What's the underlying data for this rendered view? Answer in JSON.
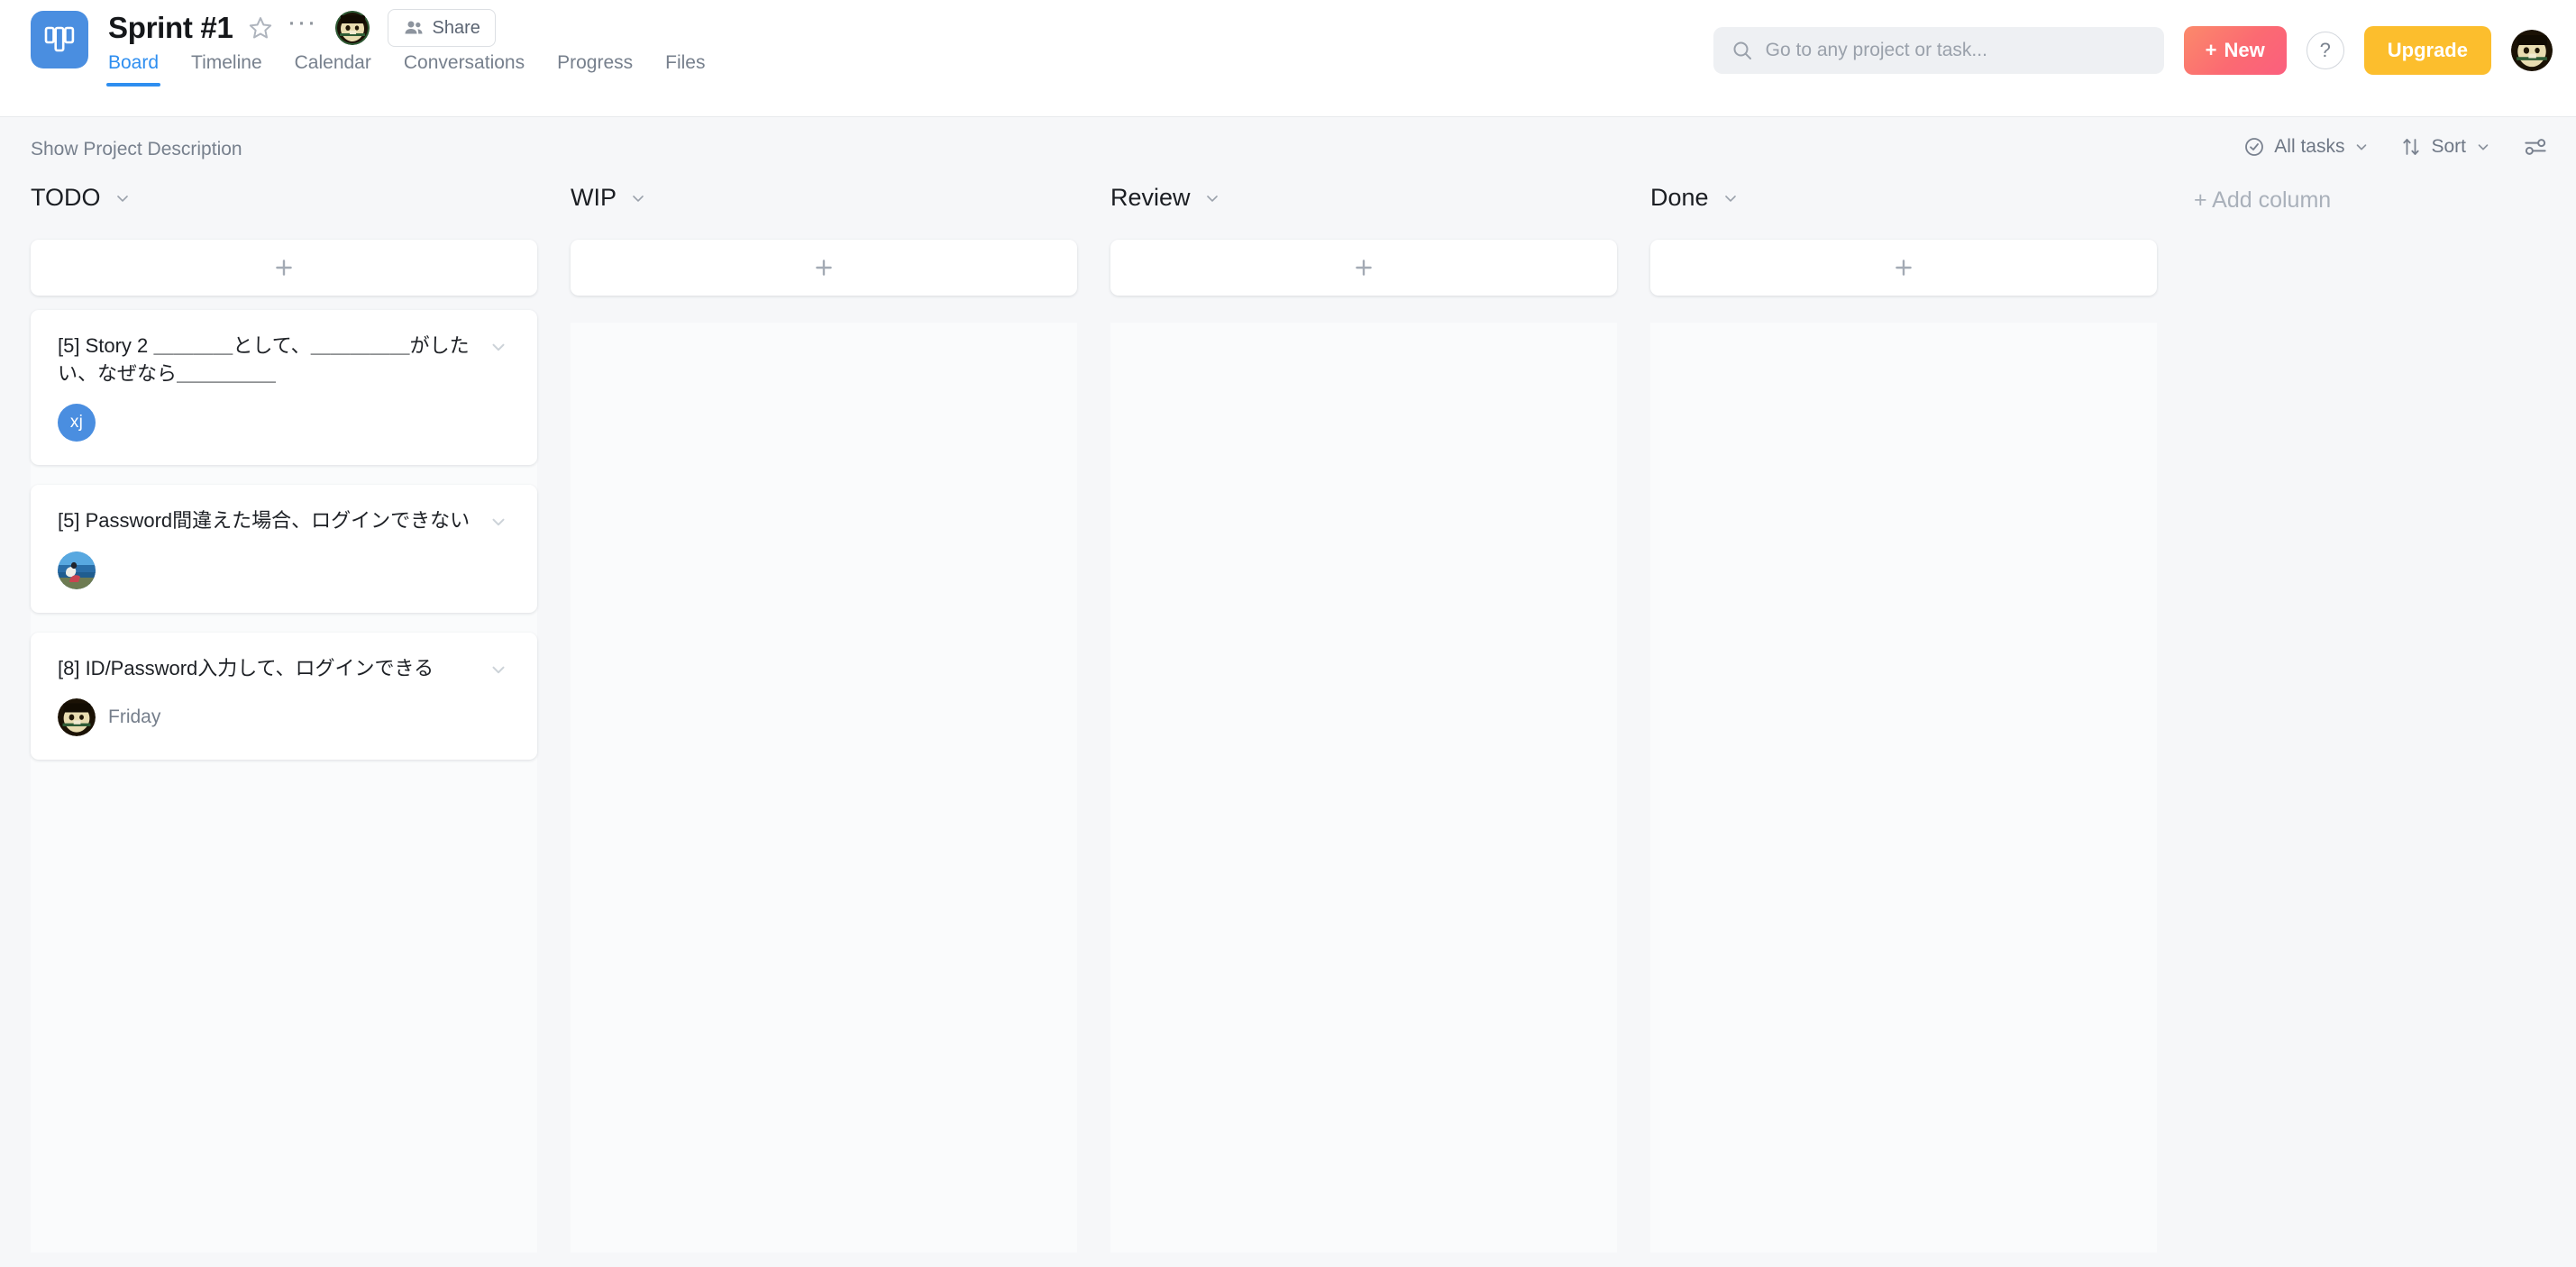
{
  "app": {
    "logo_icon": "board-logo-icon",
    "project_title": "Sprint #1",
    "star_icon": "star-icon",
    "more_icon": "more-options-icon",
    "share_label": "Share",
    "share_icon": "people-icon"
  },
  "tabs": [
    {
      "label": "Board",
      "active": true
    },
    {
      "label": "Timeline",
      "active": false
    },
    {
      "label": "Calendar",
      "active": false
    },
    {
      "label": "Conversations",
      "active": false
    },
    {
      "label": "Progress",
      "active": false
    },
    {
      "label": "Files",
      "active": false
    }
  ],
  "header_actions": {
    "search_placeholder": "Go to any project or task...",
    "search_value": "",
    "search_icon": "search-icon",
    "new_label": "New",
    "new_icon": "plus-icon",
    "help_label": "?",
    "upgrade_label": "Upgrade",
    "avatar_icon": "user-avatar"
  },
  "toolbar": {
    "show_description_label": "Show Project Description",
    "all_tasks_label": "All tasks",
    "all_tasks_icon": "check-circle-icon",
    "sort_label": "Sort",
    "sort_icon": "sort-arrows-icon",
    "settings_icon": "filter-sliders-icon",
    "chevron_icon": "chevron-down-icon"
  },
  "board": {
    "add_column_label": "+ Add column",
    "add_card_icon": "plus-icon",
    "columns": [
      {
        "name": "TODO",
        "cards": [
          {
            "title": "[5] Story 2 ＿＿＿＿として、＿＿＿＿＿がしたい、なぜなら＿＿＿＿＿",
            "avatar_type": "initials",
            "avatar_initials": "xj",
            "avatar_color": "#4a8ee0",
            "assignee": ""
          },
          {
            "title": "[5] Password間違えた場合、ログインできない",
            "avatar_type": "photo-landscape",
            "avatar_initials": "",
            "avatar_color": "",
            "assignee": ""
          },
          {
            "title": "[8] ID/Password入力して、ログインできる",
            "avatar_type": "photo-dog",
            "avatar_initials": "",
            "avatar_color": "",
            "assignee": "Friday"
          }
        ]
      },
      {
        "name": "WIP",
        "cards": []
      },
      {
        "name": "Review",
        "cards": []
      },
      {
        "name": "Done",
        "cards": []
      }
    ]
  }
}
